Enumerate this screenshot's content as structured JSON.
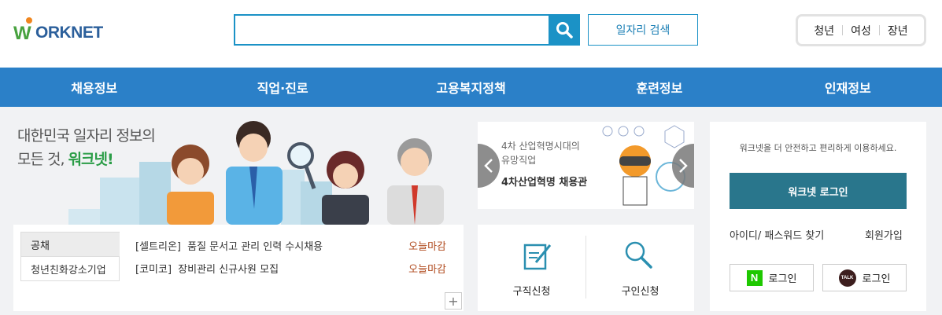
{
  "header": {
    "logo_text": "ORKNET",
    "logo_w": "W",
    "search_placeholder": "",
    "job_search_label": "일자리 검색",
    "quick_links": [
      "청년",
      "여성",
      "장년"
    ]
  },
  "nav": {
    "items": [
      "채용정보",
      "직업·진로",
      "고용복지정책",
      "훈련정보",
      "인재정보"
    ]
  },
  "hero": {
    "line1": "대한민국 일자리 정보의",
    "line2_prefix": "모든 것, ",
    "line2_highlight": "워크넷!"
  },
  "notice": {
    "tabs": [
      "공채",
      "청년친화강소기업"
    ],
    "rows": [
      {
        "company": "[셀트리온]",
        "title": "품질 문서고 관리 인력 수시채용",
        "deadline": "오늘마감"
      },
      {
        "company": "[코미코]",
        "title": "장비관리 신규사원 모집",
        "deadline": "오늘마감"
      }
    ],
    "more": "+"
  },
  "banner": {
    "subtitle": "4차 산업혁명시대의\n유망직업",
    "title": "4차산업혁명 채용관"
  },
  "apply": {
    "job_seeker": "구직신청",
    "employer": "구인신청"
  },
  "login": {
    "message": "워크넷을 더 안전하고 편리하게 이용하세요.",
    "login_button": "워크넷 로그인",
    "find_account": "아이디/ 패스워드 찾기",
    "signup": "회원가입",
    "naver_label": "로그인",
    "naver_icon_text": "N",
    "kakao_label": "로그인",
    "kakao_icon_text": "TALK"
  },
  "colors": {
    "brand_blue": "#1b92c6",
    "nav_blue": "#2b80c8",
    "login_teal": "#29768c",
    "brand_green": "#48a23f",
    "deadline": "#b04a1e"
  }
}
